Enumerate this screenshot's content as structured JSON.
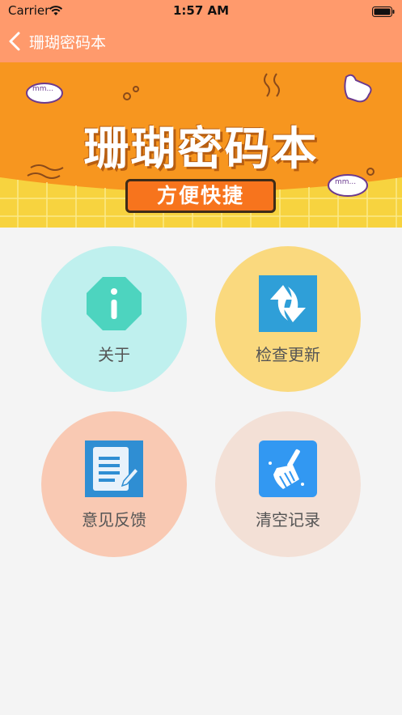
{
  "status_bar": {
    "carrier": "Carrier",
    "time": "1:57 AM"
  },
  "nav": {
    "title": "珊瑚密码本",
    "back_icon": "chevron-left-icon"
  },
  "banner": {
    "title": "珊瑚密码本",
    "subtitle": "方便快捷",
    "bubble_text": "mm..."
  },
  "menu": [
    {
      "label": "关于",
      "icon": "info-icon",
      "bg": "#bff0ee"
    },
    {
      "label": "检查更新",
      "icon": "refresh-icon",
      "bg": "#fad97e"
    },
    {
      "label": "意见反馈",
      "icon": "feedback-icon",
      "bg": "#f9c9b3"
    },
    {
      "label": "清空记录",
      "icon": "broom-icon",
      "bg": "#f3e0d6"
    }
  ],
  "colors": {
    "header": "#ff9a6c",
    "banner_orange": "#f7961f",
    "banner_yellow": "#f7d33f",
    "page_bg": "#f4f4f4"
  }
}
